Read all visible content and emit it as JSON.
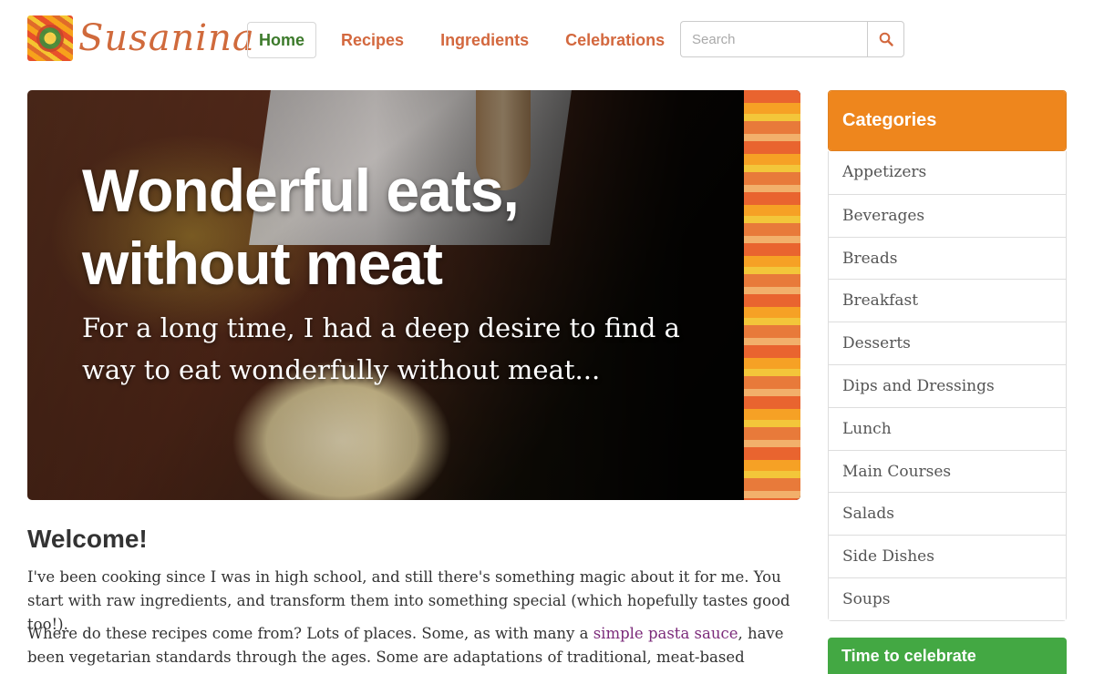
{
  "site": {
    "name": "Susanina"
  },
  "nav": {
    "items": [
      {
        "label": "Home",
        "active": true
      },
      {
        "label": "Recipes"
      },
      {
        "label": "Ingredients"
      },
      {
        "label": "Celebrations"
      }
    ]
  },
  "search": {
    "placeholder": "Search",
    "value": ""
  },
  "hero": {
    "title": "Wonderful eats, without meat",
    "subtitle": "For a long time, I had a deep desire to find a way to eat wonderfully without meat..."
  },
  "welcome": {
    "title": "Welcome!",
    "paragraph1": "I've been cooking since I was in high school, and still there's something magic about it for me. You start with raw ingredients, and transform them into something special (which hopefully tastes good too!).",
    "paragraph2_before": "Where do these recipes come from? Lots of places. Some, as with many a ",
    "paragraph2_link": "simple pasta sauce",
    "paragraph2_after": ", have been vegetarian standards through the ages. Some are adaptations of traditional, meat-based dishes. And some"
  },
  "sidebar": {
    "categories_title": "Categories",
    "categories": [
      "Appetizers",
      "Beverages",
      "Breads",
      "Breakfast",
      "Desserts",
      "Dips and Dressings",
      "Lunch",
      "Main Courses",
      "Salads",
      "Side Dishes",
      "Soups"
    ],
    "celebrate_title": "Time to celebrate"
  },
  "colors": {
    "accent_orange": "#ee861d",
    "nav_text": "#d3683e",
    "active_green": "#3c7a2b",
    "celebrate_green": "#43a843",
    "link_purple": "#7b2a7a"
  }
}
